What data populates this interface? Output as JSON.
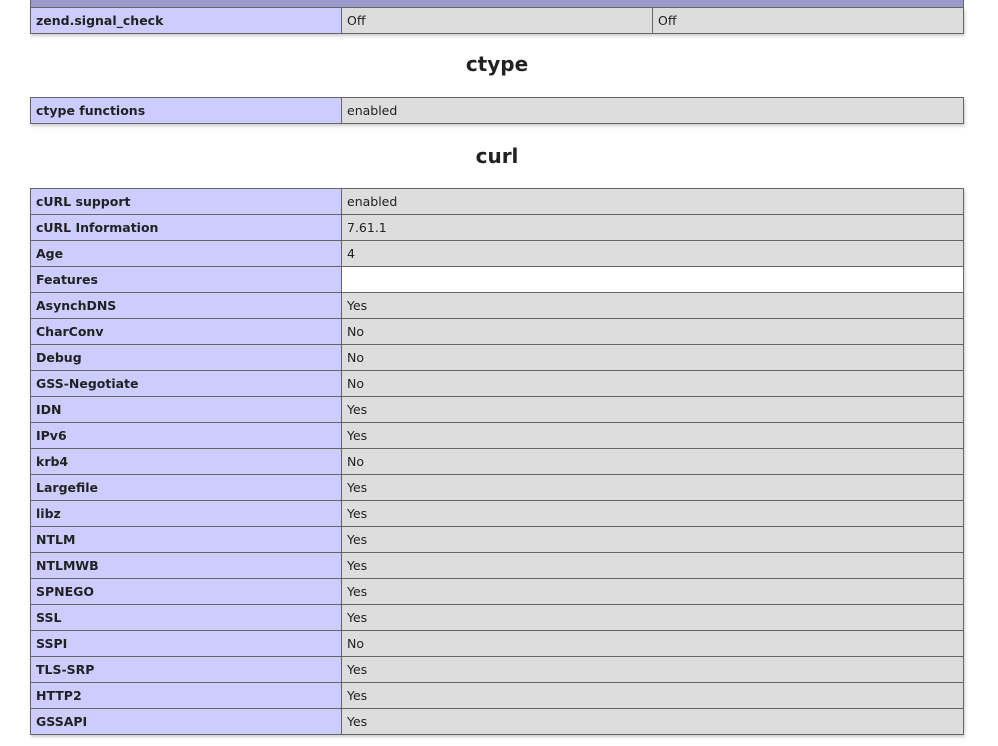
{
  "zend_row": {
    "label": "zend.signal_check",
    "local": "Off",
    "master": "Off"
  },
  "ctype": {
    "title": "ctype",
    "rows": [
      {
        "label": "ctype functions",
        "value": "enabled"
      }
    ]
  },
  "curl": {
    "title": "curl",
    "rows": [
      {
        "label": "cURL support",
        "value": "enabled"
      },
      {
        "label": "cURL Information",
        "value": "7.61.1"
      },
      {
        "label": "Age",
        "value": "4"
      },
      {
        "label": "Features",
        "value": ""
      },
      {
        "label": "AsynchDNS",
        "value": "Yes"
      },
      {
        "label": "CharConv",
        "value": "No"
      },
      {
        "label": "Debug",
        "value": "No"
      },
      {
        "label": "GSS-Negotiate",
        "value": "No"
      },
      {
        "label": "IDN",
        "value": "Yes"
      },
      {
        "label": "IPv6",
        "value": "Yes"
      },
      {
        "label": "krb4",
        "value": "No"
      },
      {
        "label": "Largefile",
        "value": "Yes"
      },
      {
        "label": "libz",
        "value": "Yes"
      },
      {
        "label": "NTLM",
        "value": "Yes"
      },
      {
        "label": "NTLMWB",
        "value": "Yes"
      },
      {
        "label": "SPNEGO",
        "value": "Yes"
      },
      {
        "label": "SSL",
        "value": "Yes"
      },
      {
        "label": "SSPI",
        "value": "No"
      },
      {
        "label": "TLS-SRP",
        "value": "Yes"
      },
      {
        "label": "HTTP2",
        "value": "Yes"
      },
      {
        "label": "GSSAPI",
        "value": "Yes"
      }
    ]
  }
}
